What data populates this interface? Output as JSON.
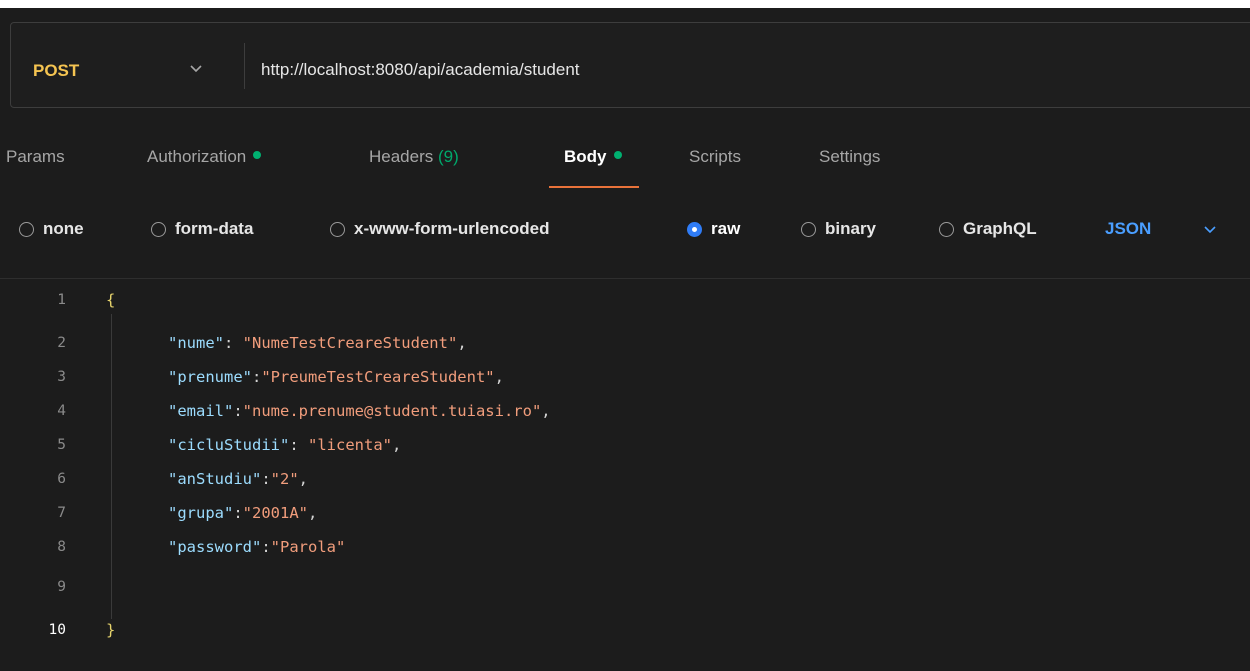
{
  "request": {
    "method": "POST",
    "url": "http://localhost:8080/api/academia/student"
  },
  "tabs": [
    {
      "label": "Params"
    },
    {
      "label": "Authorization"
    },
    {
      "label": "Headers",
      "count": "(9)"
    },
    {
      "label": "Body"
    },
    {
      "label": "Scripts"
    },
    {
      "label": "Settings"
    }
  ],
  "body_types": [
    {
      "label": "none"
    },
    {
      "label": "form-data"
    },
    {
      "label": "x-www-form-urlencoded"
    },
    {
      "label": "raw",
      "selected": true
    },
    {
      "label": "binary"
    },
    {
      "label": "GraphQL"
    }
  ],
  "body_format": "JSON",
  "editor": {
    "line_numbers": [
      "1",
      "2",
      "3",
      "4",
      "5",
      "6",
      "7",
      "8",
      "9",
      "10"
    ],
    "open_brace": "{",
    "close_brace": "}",
    "fields": [
      {
        "key": "\"nume\"",
        "sep": ": ",
        "value": "\"NumeTestCreareStudent\"",
        "trail": ","
      },
      {
        "key": "\"prenume\"",
        "sep": ":",
        "value": "\"PreumeTestCreareStudent\"",
        "trail": ","
      },
      {
        "key": "\"email\"",
        "sep": ":",
        "value": "\"nume.prenume@student.tuiasi.ro\"",
        "trail": ","
      },
      {
        "key": "\"cicluStudii\"",
        "sep": ": ",
        "value": "\"licenta\"",
        "trail": ","
      },
      {
        "key": "\"anStudiu\"",
        "sep": ":",
        "value": "\"2\"",
        "trail": ","
      },
      {
        "key": "\"grupa\"",
        "sep": ":",
        "value": "\"2001A\"",
        "trail": ","
      },
      {
        "key": "\"password\"",
        "sep": ":",
        "value": "\"Parola\"",
        "trail": ""
      }
    ]
  },
  "colors": {
    "method": "#f5c451",
    "active_tab_underline": "#e8723a",
    "status_dot": "#00b070",
    "json_select": "#4a9eff",
    "json_key": "#9cdcfe",
    "json_string": "#f19d7c"
  }
}
